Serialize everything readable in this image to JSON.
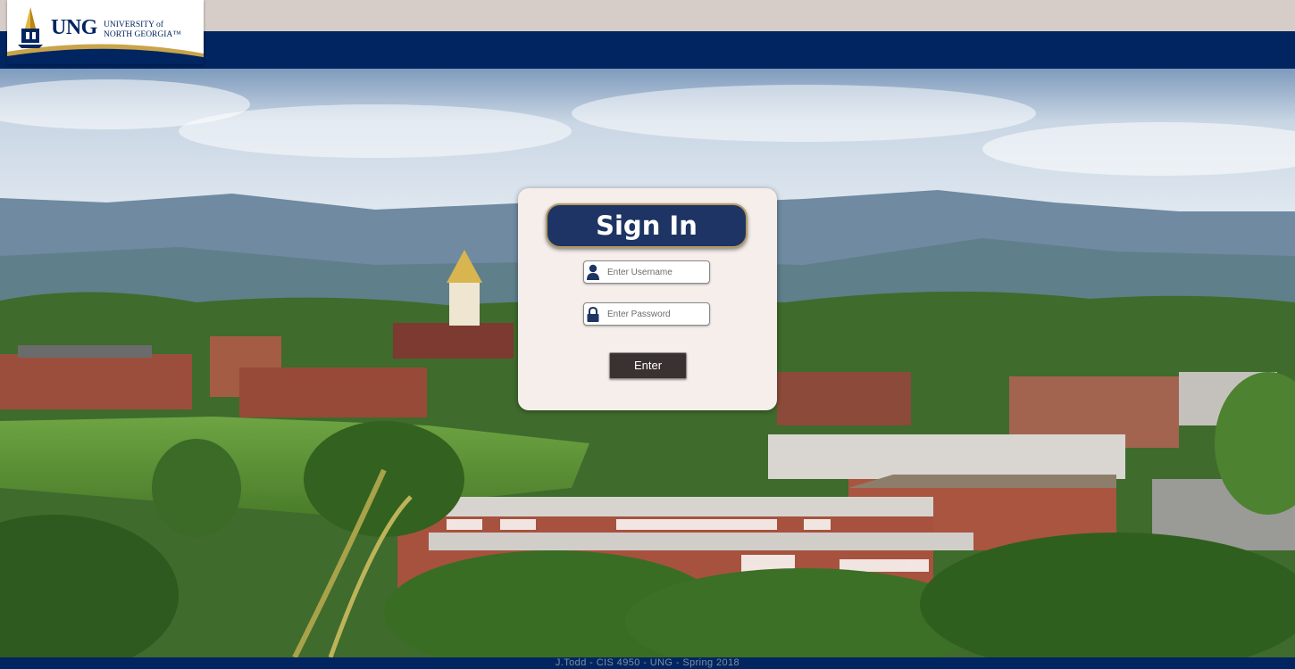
{
  "header": {
    "logo": {
      "abbr": "UNG",
      "name": "UNIVERSITY of\nNORTH GEORGIA™"
    }
  },
  "login": {
    "title": "Sign In",
    "username": {
      "placeholder": "Enter Username",
      "icon": "user-icon"
    },
    "password": {
      "placeholder": "Enter Password",
      "icon": "lock-icon"
    },
    "submit_label": "Enter"
  },
  "footer": {
    "text": "J.Todd - CIS 4950 - UNG - Spring 2018"
  },
  "colors": {
    "navy": "#002560",
    "gold": "#b49a63",
    "card": "#f5eeeb",
    "button": "#3a3230"
  }
}
